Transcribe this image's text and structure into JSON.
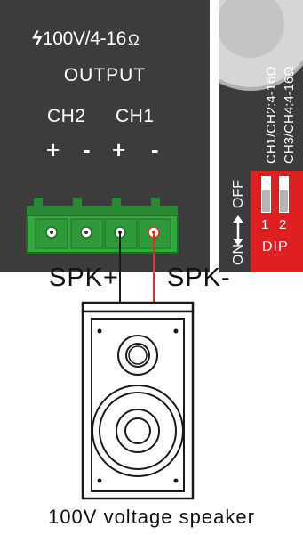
{
  "amplifier": {
    "voltage_rating": "100V/4-16",
    "ohm_symbol": "Ω",
    "output_label": "OUTPUT",
    "channels": [
      "CH2",
      "CH1"
    ],
    "polarity": [
      "+",
      "-",
      "+",
      "-"
    ],
    "bolt_icon": "lightning-bolt-icon"
  },
  "dip_panel": {
    "mapping_line_1": "CH1/CH2:4-16Ω",
    "mapping_line_2": "CH3/CH4:4-16Ω",
    "on_label": "ON",
    "off_label": "OFF",
    "switch_numbers": [
      "1",
      "2"
    ],
    "dip_label": "DIP",
    "colors": {
      "dip_block": "#e02020",
      "panel": "#3c3c3c"
    }
  },
  "wiring": {
    "spk_plus": "SPK+",
    "spk_minus": "SPK-",
    "colors": {
      "positive_wire": "#1a1a1a",
      "negative_wire": "#e0302a",
      "terminal_block": "#2e9a3a"
    }
  },
  "caption": "100V voltage speaker"
}
